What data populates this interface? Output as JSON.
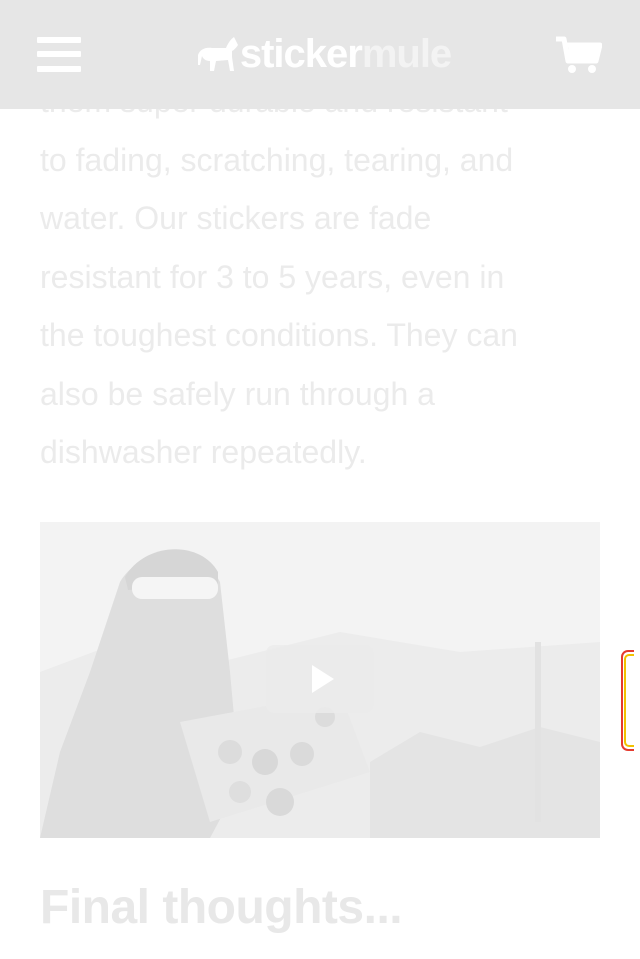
{
  "header": {
    "menu_icon": "hamburger-icon",
    "logo_part1": "sticker",
    "logo_part2": "mule",
    "logo_icon": "mule-icon",
    "cart_icon": "cart-icon"
  },
  "article": {
    "lines": [
      "them super durable and resistant",
      "to fading, scratching, tearing, and",
      "water. Our stickers are fade",
      "resistant for 3 to 5 years, even in",
      "the toughest conditions. They can",
      "also be safely run through a",
      "dishwasher repeatedly."
    ],
    "heading": "Final thoughts..."
  },
  "video": {
    "play_icon": "play-icon"
  },
  "colors": {
    "header_bg": "#e6e6e6",
    "text": "#ebebeb",
    "tab_red": "#e53b2f",
    "tab_yellow": "#f2c200"
  }
}
